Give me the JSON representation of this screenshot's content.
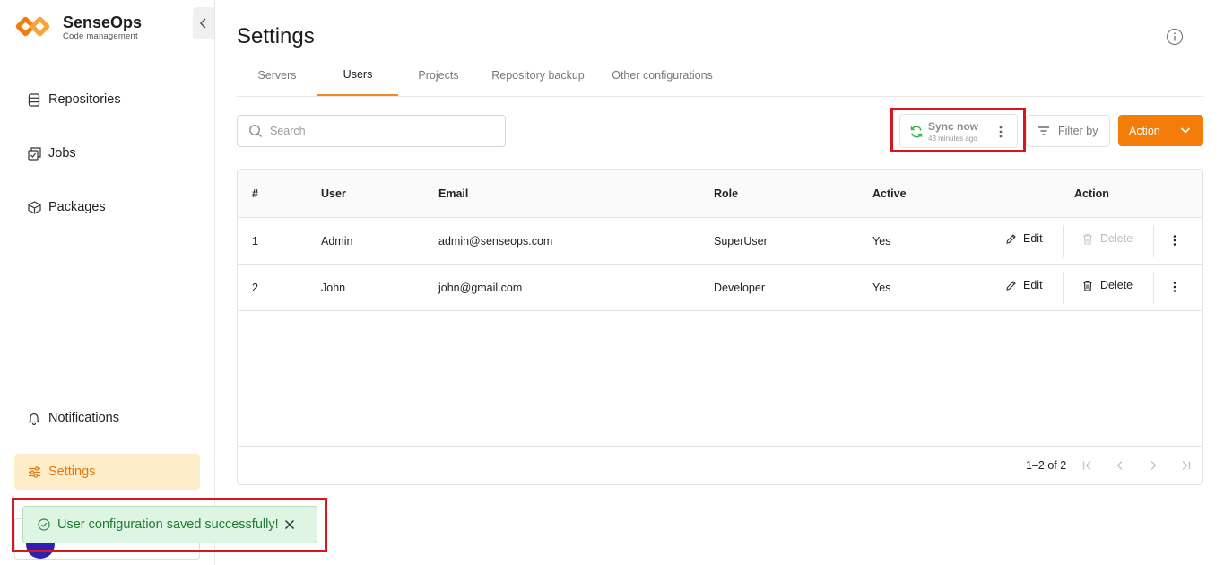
{
  "brand": {
    "name": "SenseOps",
    "subtitle": "Code management",
    "color": "#f47c08"
  },
  "sidebar": {
    "items": [
      {
        "label": "Repositories",
        "icon": "database-icon"
      },
      {
        "label": "Jobs",
        "icon": "jobs-icon"
      },
      {
        "label": "Packages",
        "icon": "package-icon"
      },
      {
        "label": "Notifications",
        "icon": "bell-icon"
      },
      {
        "label": "Settings",
        "icon": "sliders-icon",
        "active": true
      }
    ]
  },
  "page": {
    "title": "Settings"
  },
  "tabs": [
    {
      "label": "Servers"
    },
    {
      "label": "Users",
      "active": true
    },
    {
      "label": "Projects"
    },
    {
      "label": "Repository backup"
    },
    {
      "label": "Other configurations"
    }
  ],
  "toolbar": {
    "search_placeholder": "Search",
    "sync_label": "Sync now",
    "sync_time": "43 minutes ago",
    "filter_label": "Filter by",
    "action_label": "Action"
  },
  "table": {
    "headers": {
      "index": "#",
      "user": "User",
      "email": "Email",
      "role": "Role",
      "active": "Active",
      "action": "Action"
    },
    "rows": [
      {
        "index": "1",
        "user": "Admin",
        "email": "admin@senseops.com",
        "role": "SuperUser",
        "active": "Yes",
        "edit": "Edit",
        "delete": "Delete",
        "delete_disabled": true
      },
      {
        "index": "2",
        "user": "John",
        "email": "john@gmail.com",
        "role": "Developer",
        "active": "Yes",
        "edit": "Edit",
        "delete": "Delete",
        "delete_disabled": false
      }
    ],
    "pagination": {
      "text": "1–2 of 2"
    }
  },
  "toast": {
    "message": "User configuration saved successfully!",
    "color": "#1f7a34"
  }
}
